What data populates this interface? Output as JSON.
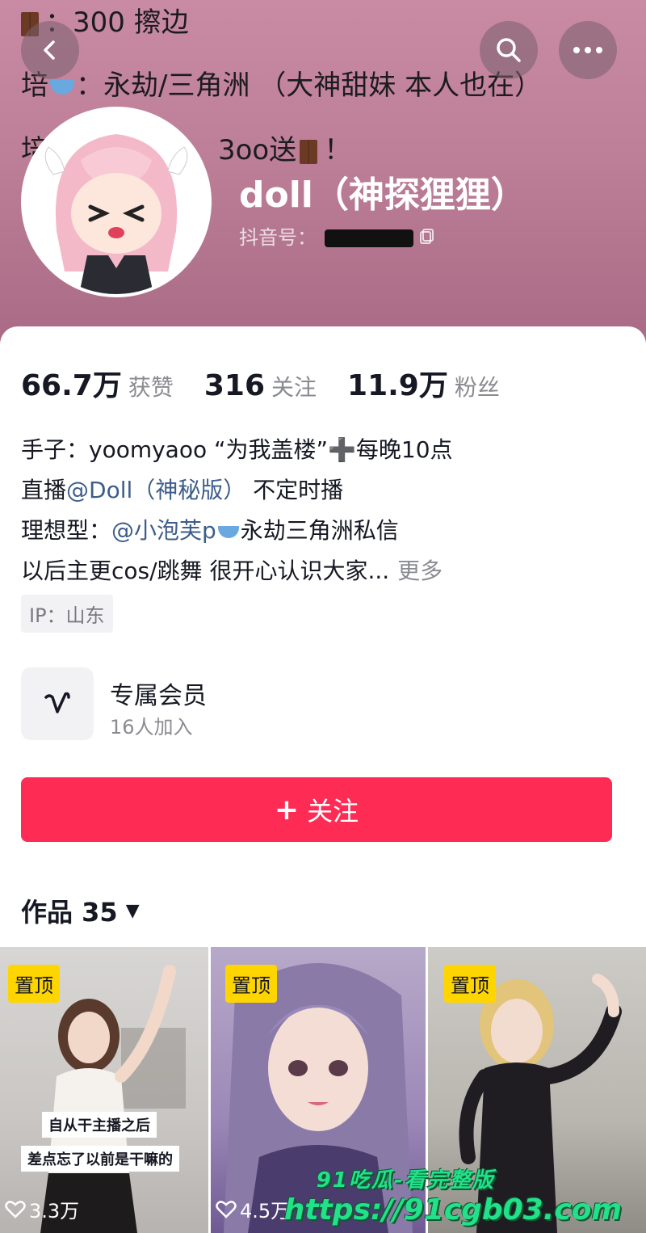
{
  "banner": {
    "line1": "：300 擦边",
    "line2_prefix": "培",
    "line2_text": "：永劫/三角洲 （大神甜妹 本人也在）",
    "line3_prefix": "培",
    "line3_text": "3oo送",
    "line3_suffix": "！"
  },
  "profile": {
    "name": "doll（神探狸狸）",
    "id_label": "抖音号："
  },
  "stats": [
    {
      "value": "66.7万",
      "label": "获赞"
    },
    {
      "value": "316",
      "label": "关注"
    },
    {
      "value": "11.9万",
      "label": "粉丝"
    }
  ],
  "bio": {
    "line1": "手子：yoomyaoo “为我盖楼”",
    "line1_after": "每晚10点",
    "line2_prefix": "直播",
    "line2_mention": "@Doll（神秘版）",
    "line2_suffix": " 不定时播",
    "line3_prefix": "理想型：",
    "line3_mention": "@小泡芙p",
    "line3_suffix": "永劫三角洲私信",
    "line4": "以后主更cos/跳舞 很开心认识大家...",
    "more": "更多"
  },
  "ip_tag": "IP：山东",
  "membership": {
    "title": "专属会员",
    "subtitle": "16人加入"
  },
  "follow_button": {
    "plus": "+",
    "label": "关注"
  },
  "works": {
    "label": "作品 35",
    "caret": "▼"
  },
  "thumbnails": [
    {
      "badge": "置顶",
      "caption1": "自从干主播之后",
      "caption2": "差点忘了以前是干嘛的",
      "likes": "3.3万"
    },
    {
      "badge": "置顶",
      "likes": "4.5万"
    },
    {
      "badge": "置顶"
    }
  ],
  "watermark": {
    "line1": "91吃瓜-看完整版",
    "line2": "https://91cgb03.com"
  },
  "icons": {
    "back": "back-icon",
    "search": "search-icon",
    "more": "more-icon",
    "member": "v-icon",
    "heart": "heart-icon"
  },
  "colors": {
    "accent": "#fe2c55",
    "pin": "#ffd500",
    "mention": "#3d5d8a",
    "watermark": "#23e08a"
  }
}
